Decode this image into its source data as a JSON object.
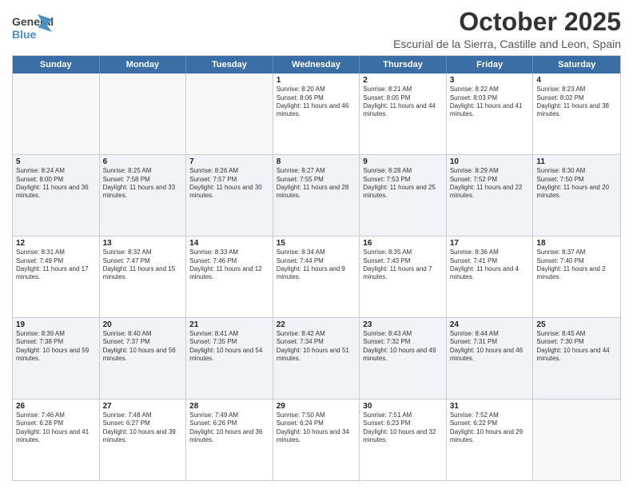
{
  "header": {
    "logo_general": "General",
    "logo_blue": "Blue",
    "month_title": "October 2025",
    "location": "Escurial de la Sierra, Castille and Leon, Spain"
  },
  "days_of_week": [
    "Sunday",
    "Monday",
    "Tuesday",
    "Wednesday",
    "Thursday",
    "Friday",
    "Saturday"
  ],
  "rows": [
    [
      {
        "day": "",
        "sunrise": "",
        "sunset": "",
        "daylight": ""
      },
      {
        "day": "",
        "sunrise": "",
        "sunset": "",
        "daylight": ""
      },
      {
        "day": "",
        "sunrise": "",
        "sunset": "",
        "daylight": ""
      },
      {
        "day": "1",
        "sunrise": "Sunrise: 8:20 AM",
        "sunset": "Sunset: 8:06 PM",
        "daylight": "Daylight: 11 hours and 46 minutes."
      },
      {
        "day": "2",
        "sunrise": "Sunrise: 8:21 AM",
        "sunset": "Sunset: 8:05 PM",
        "daylight": "Daylight: 11 hours and 44 minutes."
      },
      {
        "day": "3",
        "sunrise": "Sunrise: 8:22 AM",
        "sunset": "Sunset: 8:03 PM",
        "daylight": "Daylight: 11 hours and 41 minutes."
      },
      {
        "day": "4",
        "sunrise": "Sunrise: 8:23 AM",
        "sunset": "Sunset: 8:02 PM",
        "daylight": "Daylight: 11 hours and 38 minutes."
      }
    ],
    [
      {
        "day": "5",
        "sunrise": "Sunrise: 8:24 AM",
        "sunset": "Sunset: 8:00 PM",
        "daylight": "Daylight: 11 hours and 36 minutes."
      },
      {
        "day": "6",
        "sunrise": "Sunrise: 8:25 AM",
        "sunset": "Sunset: 7:58 PM",
        "daylight": "Daylight: 11 hours and 33 minutes."
      },
      {
        "day": "7",
        "sunrise": "Sunrise: 8:26 AM",
        "sunset": "Sunset: 7:57 PM",
        "daylight": "Daylight: 11 hours and 30 minutes."
      },
      {
        "day": "8",
        "sunrise": "Sunrise: 8:27 AM",
        "sunset": "Sunset: 7:55 PM",
        "daylight": "Daylight: 11 hours and 28 minutes."
      },
      {
        "day": "9",
        "sunrise": "Sunrise: 8:28 AM",
        "sunset": "Sunset: 7:53 PM",
        "daylight": "Daylight: 11 hours and 25 minutes."
      },
      {
        "day": "10",
        "sunrise": "Sunrise: 8:29 AM",
        "sunset": "Sunset: 7:52 PM",
        "daylight": "Daylight: 11 hours and 22 minutes."
      },
      {
        "day": "11",
        "sunrise": "Sunrise: 8:30 AM",
        "sunset": "Sunset: 7:50 PM",
        "daylight": "Daylight: 11 hours and 20 minutes."
      }
    ],
    [
      {
        "day": "12",
        "sunrise": "Sunrise: 8:31 AM",
        "sunset": "Sunset: 7:49 PM",
        "daylight": "Daylight: 11 hours and 17 minutes."
      },
      {
        "day": "13",
        "sunrise": "Sunrise: 8:32 AM",
        "sunset": "Sunset: 7:47 PM",
        "daylight": "Daylight: 11 hours and 15 minutes."
      },
      {
        "day": "14",
        "sunrise": "Sunrise: 8:33 AM",
        "sunset": "Sunset: 7:46 PM",
        "daylight": "Daylight: 11 hours and 12 minutes."
      },
      {
        "day": "15",
        "sunrise": "Sunrise: 8:34 AM",
        "sunset": "Sunset: 7:44 PM",
        "daylight": "Daylight: 11 hours and 9 minutes."
      },
      {
        "day": "16",
        "sunrise": "Sunrise: 8:35 AM",
        "sunset": "Sunset: 7:43 PM",
        "daylight": "Daylight: 11 hours and 7 minutes."
      },
      {
        "day": "17",
        "sunrise": "Sunrise: 8:36 AM",
        "sunset": "Sunset: 7:41 PM",
        "daylight": "Daylight: 11 hours and 4 minutes."
      },
      {
        "day": "18",
        "sunrise": "Sunrise: 8:37 AM",
        "sunset": "Sunset: 7:40 PM",
        "daylight": "Daylight: 11 hours and 2 minutes."
      }
    ],
    [
      {
        "day": "19",
        "sunrise": "Sunrise: 8:39 AM",
        "sunset": "Sunset: 7:38 PM",
        "daylight": "Daylight: 10 hours and 59 minutes."
      },
      {
        "day": "20",
        "sunrise": "Sunrise: 8:40 AM",
        "sunset": "Sunset: 7:37 PM",
        "daylight": "Daylight: 10 hours and 56 minutes."
      },
      {
        "day": "21",
        "sunrise": "Sunrise: 8:41 AM",
        "sunset": "Sunset: 7:35 PM",
        "daylight": "Daylight: 10 hours and 54 minutes."
      },
      {
        "day": "22",
        "sunrise": "Sunrise: 8:42 AM",
        "sunset": "Sunset: 7:34 PM",
        "daylight": "Daylight: 10 hours and 51 minutes."
      },
      {
        "day": "23",
        "sunrise": "Sunrise: 8:43 AM",
        "sunset": "Sunset: 7:32 PM",
        "daylight": "Daylight: 10 hours and 49 minutes."
      },
      {
        "day": "24",
        "sunrise": "Sunrise: 8:44 AM",
        "sunset": "Sunset: 7:31 PM",
        "daylight": "Daylight: 10 hours and 46 minutes."
      },
      {
        "day": "25",
        "sunrise": "Sunrise: 8:45 AM",
        "sunset": "Sunset: 7:30 PM",
        "daylight": "Daylight: 10 hours and 44 minutes."
      }
    ],
    [
      {
        "day": "26",
        "sunrise": "Sunrise: 7:46 AM",
        "sunset": "Sunset: 6:28 PM",
        "daylight": "Daylight: 10 hours and 41 minutes."
      },
      {
        "day": "27",
        "sunrise": "Sunrise: 7:48 AM",
        "sunset": "Sunset: 6:27 PM",
        "daylight": "Daylight: 10 hours and 39 minutes."
      },
      {
        "day": "28",
        "sunrise": "Sunrise: 7:49 AM",
        "sunset": "Sunset: 6:26 PM",
        "daylight": "Daylight: 10 hours and 36 minutes."
      },
      {
        "day": "29",
        "sunrise": "Sunrise: 7:50 AM",
        "sunset": "Sunset: 6:24 PM",
        "daylight": "Daylight: 10 hours and 34 minutes."
      },
      {
        "day": "30",
        "sunrise": "Sunrise: 7:51 AM",
        "sunset": "Sunset: 6:23 PM",
        "daylight": "Daylight: 10 hours and 32 minutes."
      },
      {
        "day": "31",
        "sunrise": "Sunrise: 7:52 AM",
        "sunset": "Sunset: 6:22 PM",
        "daylight": "Daylight: 10 hours and 29 minutes."
      },
      {
        "day": "",
        "sunrise": "",
        "sunset": "",
        "daylight": ""
      }
    ]
  ]
}
